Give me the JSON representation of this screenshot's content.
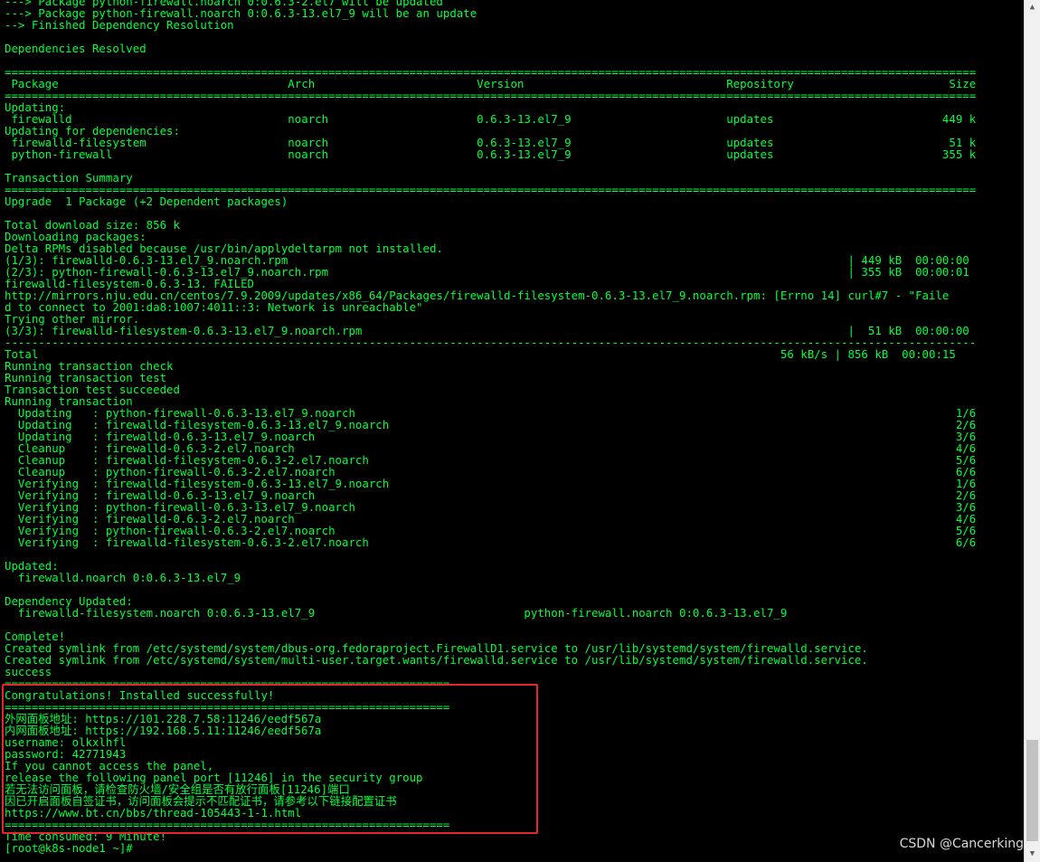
{
  "terminal": {
    "lines": [
      "---> Package python-firewall.noarch 0:0.6.3-2.el7 will be updated",
      "---> Package python-firewall.noarch 0:0.6.3-13.el7_9 will be an update",
      "--> Finished Dependency Resolution",
      "",
      "Dependencies Resolved",
      "",
      "================================================================================================================================================",
      " Package                                  Arch                        Version                              Repository                       Size",
      "================================================================================================================================================",
      "Updating:",
      " firewalld                                noarch                      0.6.3-13.el7_9                       updates                         449 k",
      "Updating for dependencies:",
      " firewalld-filesystem                     noarch                      0.6.3-13.el7_9                       updates                          51 k",
      " python-firewall                          noarch                      0.6.3-13.el7_9                       updates                         355 k",
      "",
      "Transaction Summary",
      "================================================================================================================================================",
      "Upgrade  1 Package (+2 Dependent packages)",
      "",
      "Total download size: 856 k",
      "Downloading packages:",
      "Delta RPMs disabled because /usr/bin/applydeltarpm not installed.",
      "(1/3): firewalld-0.6.3-13.el7_9.noarch.rpm                                                                                   | 449 kB  00:00:00",
      "(2/3): python-firewall-0.6.3-13.el7_9.noarch.rpm                                                                             | 355 kB  00:00:01",
      "firewalld-filesystem-0.6.3-13. FAILED",
      "http://mirrors.nju.edu.cn/centos/7.9.2009/updates/x86_64/Packages/firewalld-filesystem-0.6.3-13.el7_9.noarch.rpm: [Errno 14] curl#7 - \"Faile",
      "d to connect to 2001:da8:1007:4011::3: Network is unreachable\"",
      "Trying other mirror.",
      "(3/3): firewalld-filesystem-0.6.3-13.el7_9.noarch.rpm                                                                        |  51 kB  00:00:00",
      "------------------------------------------------------------------------------------------------------------------------------------------------",
      "Total                                                                                                              56 kB/s | 856 kB  00:00:15",
      "Running transaction check",
      "Running transaction test",
      "Transaction test succeeded",
      "Running transaction",
      "  Updating   : python-firewall-0.6.3-13.el7_9.noarch                                                                                         1/6",
      "  Updating   : firewalld-filesystem-0.6.3-13.el7_9.noarch                                                                                    2/6",
      "  Updating   : firewalld-0.6.3-13.el7_9.noarch                                                                                               3/6",
      "  Cleanup    : firewalld-0.6.3-2.el7.noarch                                                                                                  4/6",
      "  Cleanup    : firewalld-filesystem-0.6.3-2.el7.noarch                                                                                       5/6",
      "  Cleanup    : python-firewall-0.6.3-2.el7.noarch                                                                                            6/6",
      "  Verifying  : firewalld-filesystem-0.6.3-13.el7_9.noarch                                                                                    1/6",
      "  Verifying  : firewalld-0.6.3-13.el7_9.noarch                                                                                               2/6",
      "  Verifying  : python-firewall-0.6.3-13.el7_9.noarch                                                                                         3/6",
      "  Verifying  : firewalld-0.6.3-2.el7.noarch                                                                                                  4/6",
      "  Verifying  : python-firewall-0.6.3-2.el7.noarch                                                                                            5/6",
      "  Verifying  : firewalld-filesystem-0.6.3-2.el7.noarch                                                                                       6/6",
      "",
      "Updated:",
      "  firewalld.noarch 0:0.6.3-13.el7_9",
      "",
      "Dependency Updated:",
      "  firewalld-filesystem.noarch 0:0.6.3-13.el7_9                               python-firewall.noarch 0:0.6.3-13.el7_9",
      "",
      "Complete!",
      "Created symlink from /etc/systemd/system/dbus-org.fedoraproject.FirewallD1.service to /usr/lib/systemd/system/firewalld.service.",
      "Created symlink from /etc/systemd/system/multi-user.target.wants/firewalld.service to /usr/lib/systemd/system/firewalld.service.",
      "success",
      "==================================================================",
      "Congratulations! Installed successfully!",
      "==================================================================",
      "外网面板地址: https://101.228.7.58:11246/eedf567a",
      "内网面板地址: https://192.168.5.11:11246/eedf567a",
      "username: olkxlhfl",
      "password: 42771943",
      "If you cannot access the panel,",
      "release the following panel port [11246] in the security group",
      "若无法访问面板，请检查防火墙/安全组是否有放行面板[11246]端口",
      "因已开启面板自签证书，访问面板会提示不匹配证书，请参考以下链接配置证书",
      "https://www.bt.cn/bbs/thread-105443-1-1.html",
      "==================================================================",
      "Time consumed: 9 Minute!",
      "[root@k8s-node1 ~]# "
    ]
  },
  "watermark": "CSDN @Cancerking",
  "highlight_color": "#e3272a",
  "text_color": "#00ff3c",
  "icons": {
    "scroll_up": "up-arrow-icon",
    "scroll_down": "down-arrow-icon"
  }
}
